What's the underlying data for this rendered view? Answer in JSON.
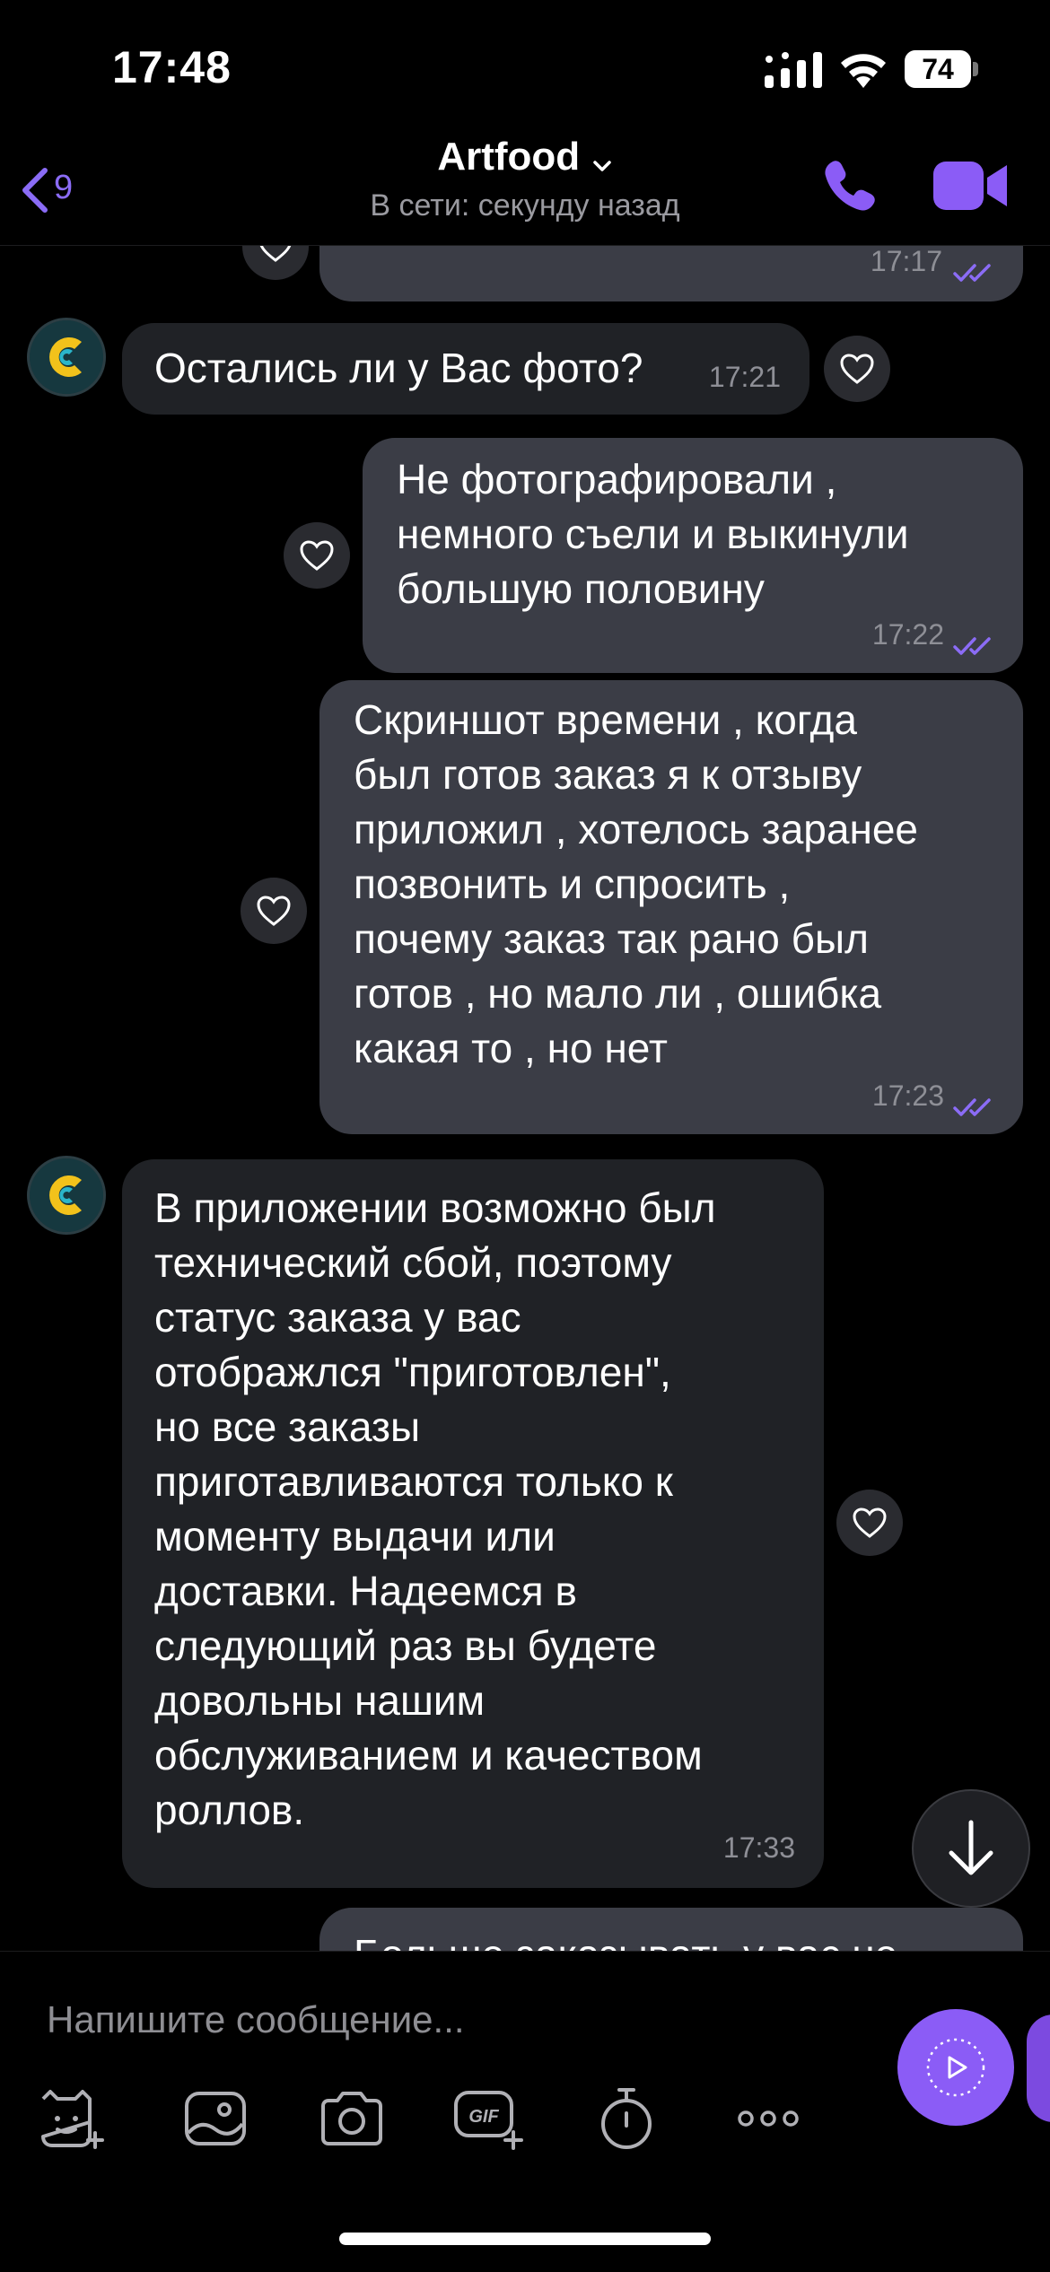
{
  "status_bar": {
    "time": "17:48",
    "battery": "74"
  },
  "header": {
    "back_count": "9",
    "title": "Artfood",
    "subtitle": "В сети: секунду назад"
  },
  "messages": [
    {
      "direction": "out",
      "text": "",
      "time": "17:17",
      "status": "read"
    },
    {
      "direction": "in",
      "text": "Остались ли у Вас фото?",
      "time": "17:21"
    },
    {
      "direction": "out",
      "text": "Не фотографировали ,\nнемного съели и выкинули\nбольшую половину",
      "time": "17:22",
      "status": "read"
    },
    {
      "direction": "out",
      "text": "Скриншот времени , когда\nбыл готов заказ я к отзыву\nприложил , хотелось заранее\nпозвонить и спросить ,\nпочему заказ так рано был\nготов , но мало ли , ошибка\nкакая то , но нет",
      "time": "17:23",
      "status": "read"
    },
    {
      "direction": "in",
      "text": "В приложении возможно был\nтехнический сбой, поэтому\nстатус заказа у вас\nотображлся \"приготовлен\",\nно все заказы\nприготавливаются только к\nмоменту выдачи или\nдоставки. Надеемся в\nследующий раз вы будете\nдовольны нашим\nобслуживанием и качеством\nроллов.",
      "time": "17:33"
    },
    {
      "direction": "out",
      "text": "Больше заказывать у вас не",
      "time": "",
      "status": ""
    }
  ],
  "composer": {
    "placeholder": "Напишите сообщение..."
  },
  "icons": {
    "back": "chevron-left-icon",
    "call": "phone-icon",
    "video": "video-camera-icon",
    "like": "heart-icon",
    "scroll_down": "arrow-down-icon",
    "send": "play-icon",
    "stickers": "sticker-icon",
    "gallery": "gallery-icon",
    "camera": "camera-icon",
    "gif": "gif-icon",
    "timer": "stopwatch-icon",
    "more": "more-icon"
  },
  "colors": {
    "accent": "#8b5cf6",
    "outgoing_bubble": "#3b3d46",
    "incoming_bubble": "#202226",
    "read_tick": "#8b6cf6"
  }
}
